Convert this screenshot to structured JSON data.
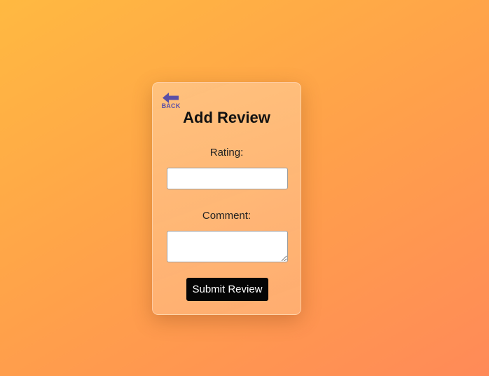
{
  "form": {
    "back_label": "BACK",
    "title": "Add Review",
    "rating_label": "Rating:",
    "rating_value": "",
    "rating_placeholder": "",
    "comment_label": "Comment:",
    "comment_value": "",
    "comment_placeholder": "",
    "submit_label": "Submit Review"
  },
  "icons": {
    "back": "arrow-left-icon"
  },
  "colors": {
    "background_start": "#ffb941",
    "background_end": "#ff8a58",
    "back_icon": "#5a4fa6",
    "submit_bg": "#050505",
    "submit_text": "#ffffff"
  }
}
